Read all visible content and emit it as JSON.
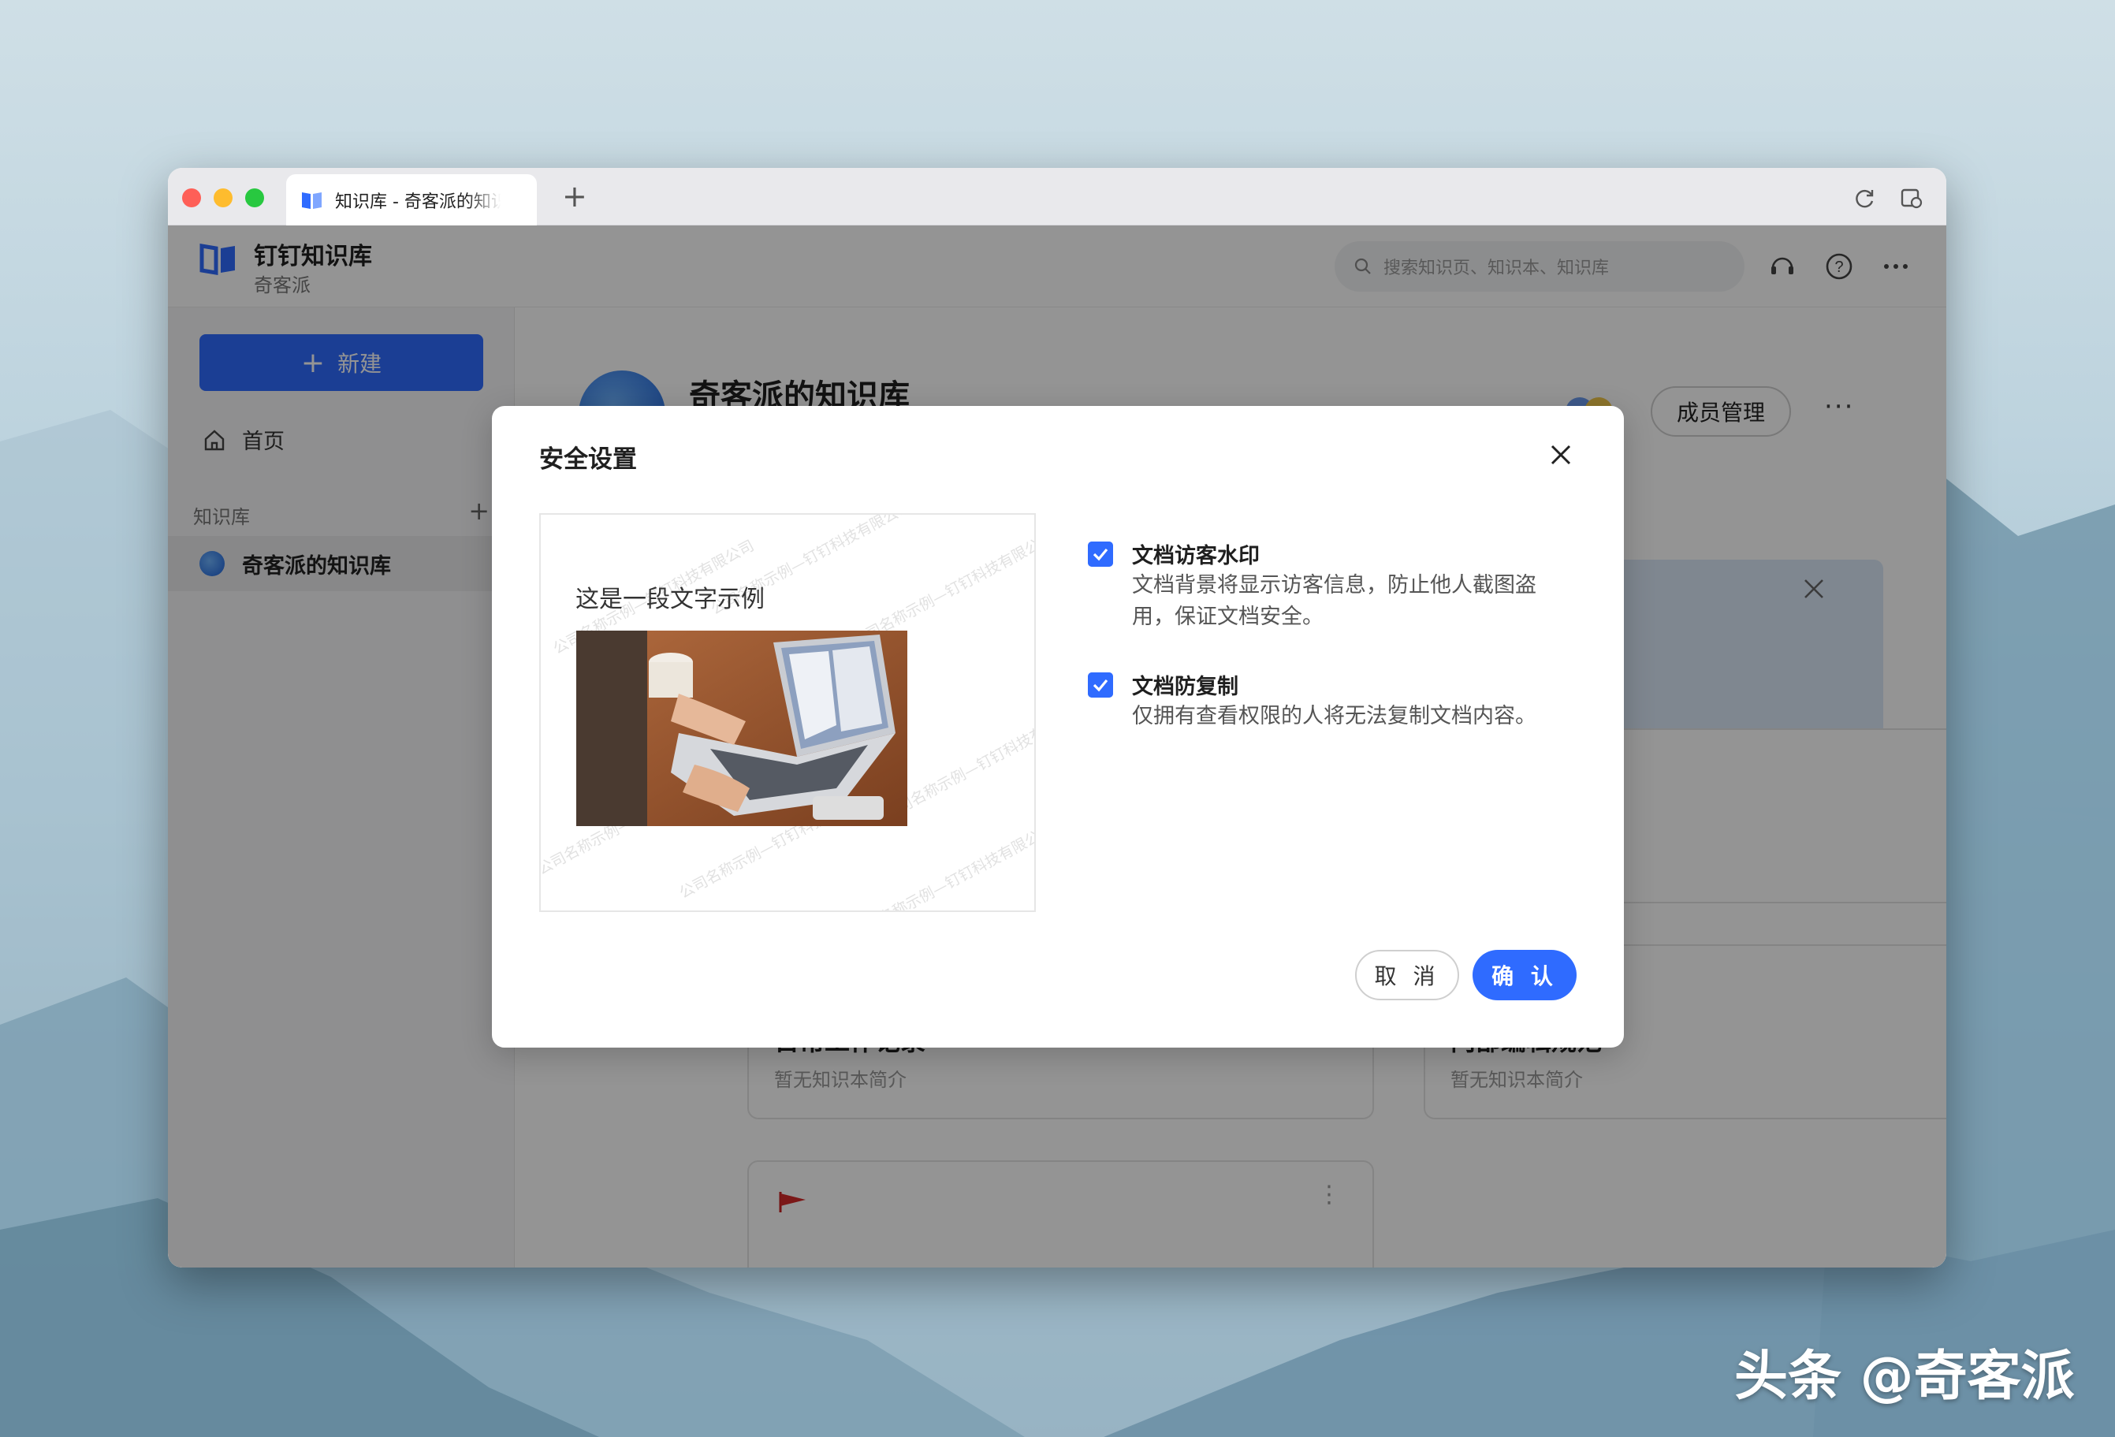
{
  "browser": {
    "tab_title": "知识库 - 奇客派的知识库",
    "new_tab_symbol": "+"
  },
  "app": {
    "name": "钉钉知识库",
    "org": "奇客派",
    "search_placeholder": "搜索知识页、知识本、知识库",
    "accent_color": "#2f6bff"
  },
  "sidebar": {
    "new_button": "新建",
    "home": "首页",
    "section_label": "知识库",
    "section_add": "+",
    "kb_item": "奇客派的知识库"
  },
  "main": {
    "kb_title": "奇客派的知识库",
    "member_button": "成员管理",
    "more": "···",
    "cards": [
      {
        "title": "日常工作记录",
        "desc": "暂无知识本简介"
      },
      {
        "title": "内部编辑规范",
        "desc": "暂无知识本简介"
      }
    ]
  },
  "modal": {
    "title": "安全设置",
    "preview_text": "这是一段文字示例",
    "watermark_text": "公司名称示例—钉钉科技有限公司",
    "options": [
      {
        "title": "文档访客水印",
        "desc": "文档背景将显示访客信息，防止他人截图盗用，保证文档安全。",
        "checked": true
      },
      {
        "title": "文档防复制",
        "desc": "仅拥有查看权限的人将无法复制文档内容。",
        "checked": true
      }
    ],
    "cancel": "取 消",
    "confirm": "确 认"
  },
  "overlay_text": "头条 @奇客派"
}
